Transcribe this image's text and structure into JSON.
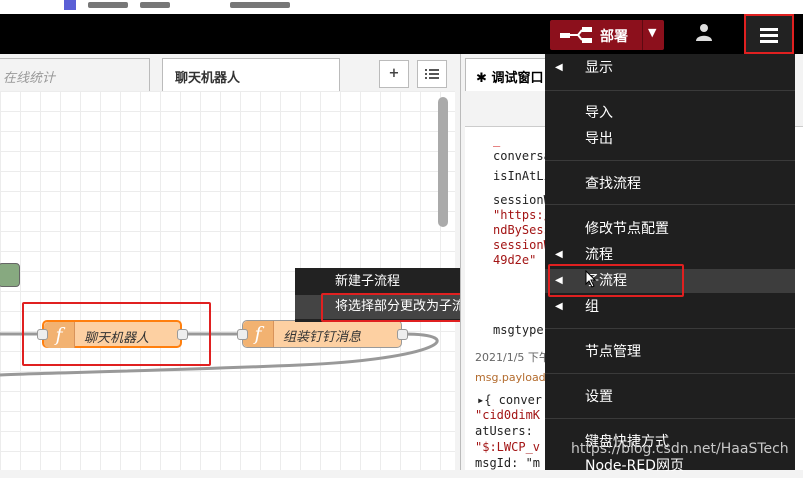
{
  "header": {
    "deploy_label": "部署"
  },
  "tabs": [
    {
      "label": "在线统计"
    },
    {
      "label": "聊天机器人"
    }
  ],
  "workspace": {
    "nodes": [
      {
        "label": "聊天机器人"
      },
      {
        "label": "组装钉钉消息"
      }
    ]
  },
  "context_menu": {
    "items": [
      {
        "label": "新建子流程"
      },
      {
        "label": "将选择部分更改为子流程"
      }
    ]
  },
  "sidebar": {
    "tab_label": "调试窗口",
    "debug_lines": [
      "conversa",
      "isInAtLi",
      "sessionW",
      "\"https:/",
      "ndBySess",
      "sessionW",
      "49d2e\"",
      "msgtype"
    ],
    "timestamp": "2021/1/5 下午",
    "msg_payload": "msg.payload :",
    "object_lines": [
      "▸{ conver",
      "\"cid0dimK",
      "atUsers:",
      "\"$:LWCP_v",
      "msgId: \"m"
    ]
  },
  "main_menu": {
    "items": [
      {
        "label": "显示",
        "arrow": true
      },
      {
        "label": "导入",
        "arrow": false
      },
      {
        "label": "导出",
        "arrow": false
      },
      {
        "label": "查找流程",
        "arrow": false
      },
      {
        "label": "修改节点配置",
        "arrow": false
      },
      {
        "label": "流程",
        "arrow": true
      },
      {
        "label": "子流程",
        "arrow": true
      },
      {
        "label": "组",
        "arrow": true
      },
      {
        "label": "节点管理",
        "arrow": false
      },
      {
        "label": "设置",
        "arrow": false
      },
      {
        "label": "键盘快捷方式",
        "arrow": false
      },
      {
        "label": "Node-RED网页",
        "arrow": false
      }
    ]
  },
  "watermark": "https://blog.csdn.net/HaaSTech",
  "colors": {
    "deploy_bg": "#8c101c",
    "function_node": "#fdd0a2",
    "highlight_box": "#e02020"
  }
}
